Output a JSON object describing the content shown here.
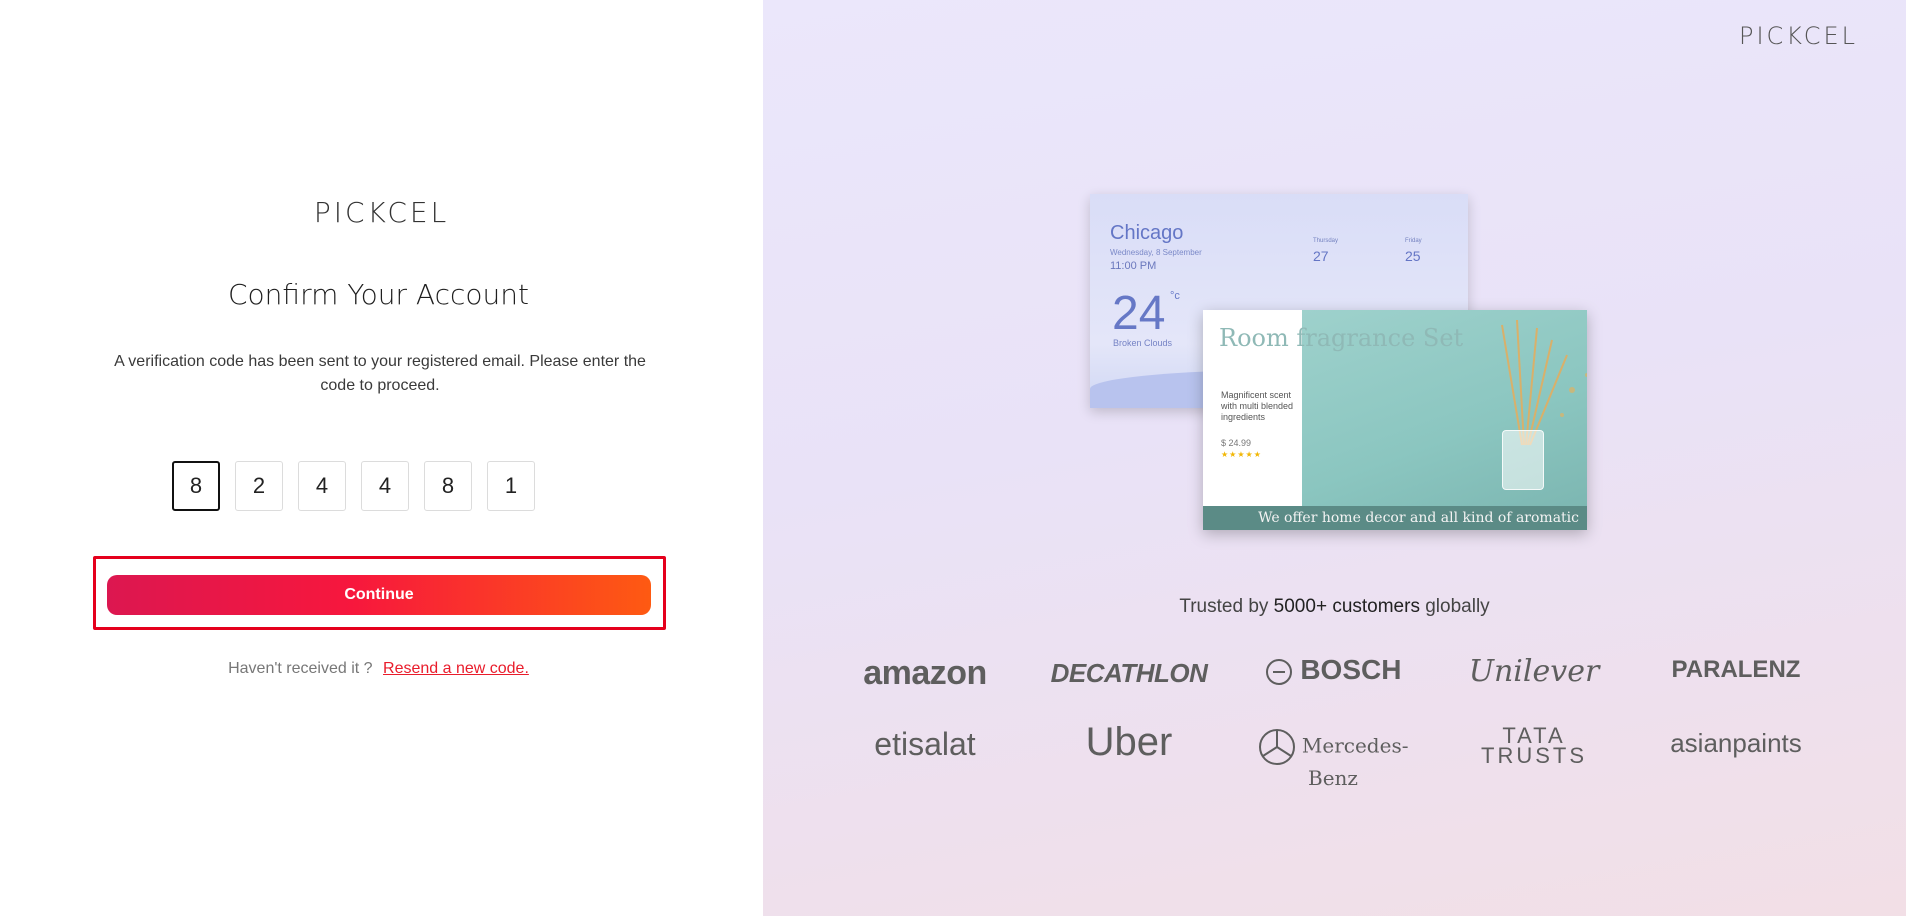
{
  "brand": {
    "logo_text": "PICKCEL"
  },
  "form": {
    "title": "Confirm Your Account",
    "description": "A verification code has been sent to your registered email. Please enter the code to proceed.",
    "otp_digits": [
      "8",
      "2",
      "4",
      "4",
      "8",
      "1"
    ],
    "continue_label": "Continue",
    "resend_prompt": "Haven't received it ?",
    "resend_link": "Resend a new code."
  },
  "colors": {
    "accent_start": "#dc1750",
    "accent_end": "#fe5a12",
    "highlight_border": "#e5001c",
    "link": "#e91c2b"
  },
  "preview": {
    "weather": {
      "city": "Chicago",
      "date": "Wednesday, 8 September",
      "time": "11:00 PM",
      "temperature": "24",
      "unit": "°c",
      "condition": "Broken Clouds",
      "day1": "Thursday",
      "day1_temp": "27",
      "day2": "Friday",
      "day2_temp": "25"
    },
    "promo": {
      "title": "Room fragrance Set",
      "description": "Magnificent scent with multi blended ingredients",
      "price": "$ 24.99",
      "stars": "★★★★★",
      "banner": "We offer home decor and all kind of aromatic lifestyle"
    }
  },
  "trusted": {
    "prefix": "Trusted by",
    "count": "5000+ customers",
    "suffix": "globally"
  },
  "customers": {
    "row1": [
      "amazon",
      "DECATHLON",
      "BOSCH",
      "Unilever",
      "PARALENZ"
    ],
    "row2": [
      "etisalat",
      "Uber",
      "Mercedes-Benz",
      "TATA TRUSTS",
      "asianpaints"
    ]
  }
}
